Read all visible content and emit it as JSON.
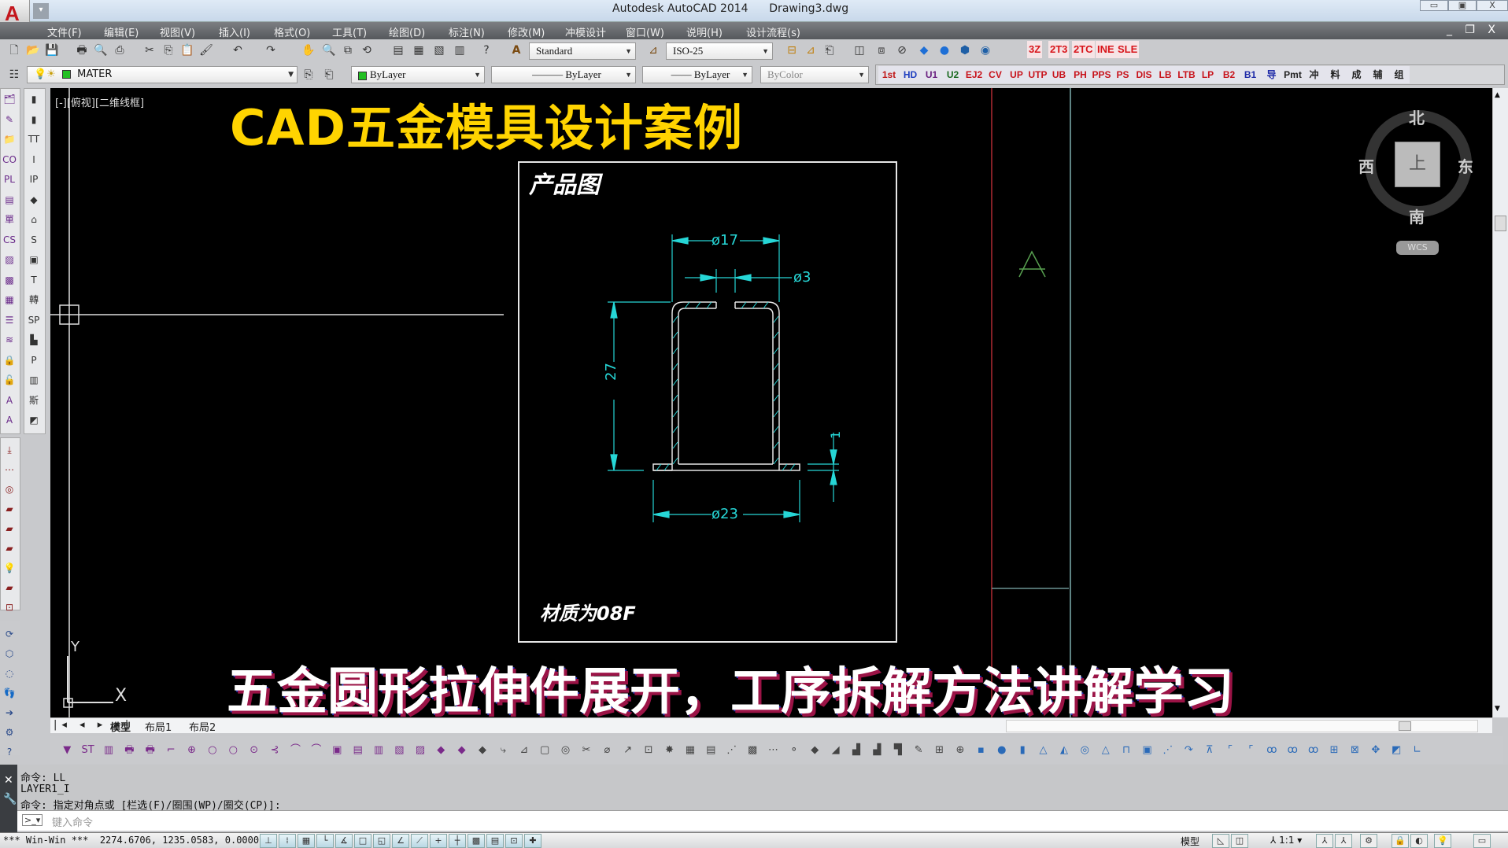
{
  "titlebar": {
    "app": "Autodesk AutoCAD 2014",
    "file": "Drawing3.dwg",
    "minimize": "▭",
    "maximize": "▣",
    "close": "X"
  },
  "menu": [
    "文件(F)",
    "编辑(E)",
    "视图(V)",
    "插入(I)",
    "格式(O)",
    "工具(T)",
    "绘图(D)",
    "标注(N)",
    "修改(M)",
    "冲模设计",
    "窗口(W)",
    "说明(H)",
    "设计流程(s)"
  ],
  "mdi_controls": "_ ❐ X",
  "toolbar": {
    "text_style": "Standard",
    "dim_style": "ISO-25",
    "red_tools": [
      "3Z",
      "2T3",
      "2TC",
      "INE",
      "SLE"
    ],
    "layer": "MATER",
    "color": "ByLayer",
    "linetype": "ByLayer",
    "lineweight": "ByLayer",
    "plotstyle": "ByColor",
    "custom_tools": [
      "1st",
      "HD",
      "U1",
      "U2",
      "EJ2",
      "CV",
      "UP",
      "UTP",
      "UB",
      "PH",
      "PPS",
      "PS",
      "DIS",
      "LB",
      "LTB",
      "LP",
      "B2",
      "B1",
      "导",
      "Pmt",
      "冲",
      "料",
      "成",
      "辅",
      "组"
    ]
  },
  "viewport": {
    "label": "[-][俯视][二维线框]",
    "overlay_title": "CAD五金模具设计案例",
    "overlay_subtitle": "五金圆形拉伸件展开，工序拆解方法讲解学习",
    "ucs_x": "X",
    "ucs_y": "Y",
    "section_mark": "A",
    "colors": {
      "background": "#000000",
      "dimension": "#26d6d6",
      "outline": "#e6e6e6",
      "red_line": "#b02a32",
      "cyan_line": "#7fb0b0",
      "green_mark": "#58a050"
    }
  },
  "product_drawing": {
    "title": "产品图",
    "material_note": "材质为08F",
    "dims": {
      "top_diameter": "ø17",
      "hole_diameter": "ø3",
      "height": "27",
      "flange_diameter": "ø23",
      "thickness": "1"
    }
  },
  "viewcube": {
    "north": "北",
    "south": "南",
    "east": "东",
    "west": "西",
    "top": "上",
    "wcs": "WCS"
  },
  "tabs": {
    "model": "模型",
    "layout1": "布局1",
    "layout2": "布局2"
  },
  "command": {
    "history": [
      "命令: LL",
      "LAYER1_I",
      "命令: 指定对角点或 [栏选(F)/圈围(WP)/圈交(CP)]:"
    ],
    "placeholder": "键入命令"
  },
  "statusbar": {
    "coords": "*** Win-Win ***  2274.6706, 1235.0583, 0.0000",
    "space": "模型",
    "scale": "1:1"
  }
}
